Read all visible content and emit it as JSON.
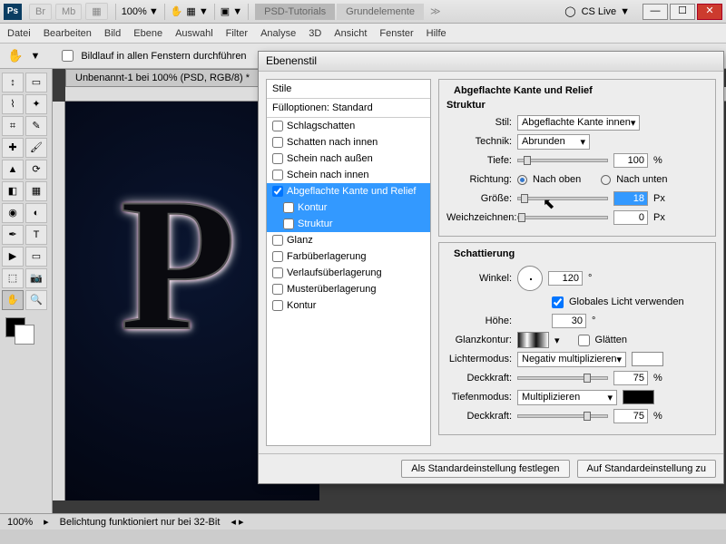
{
  "titlebar": {
    "zoom": "100%",
    "tabs": [
      "PSD-Tutorials",
      "Grundelemente"
    ],
    "cslive": "CS Live"
  },
  "menu": [
    "Datei",
    "Bearbeiten",
    "Bild",
    "Ebene",
    "Auswahl",
    "Filter",
    "Analyse",
    "3D",
    "Ansicht",
    "Fenster",
    "Hilfe"
  ],
  "options": {
    "scroll_all": "Bildlauf in allen Fenstern durchführen"
  },
  "doc": {
    "tab": "Unbenannt-1 bei 100% (PSD, RGB/8) *"
  },
  "dialog": {
    "title": "Ebenenstil",
    "list_header": "Stile",
    "blend_header": "Fülloptionen: Standard",
    "items": [
      {
        "label": "Schlagschatten",
        "on": false
      },
      {
        "label": "Schatten nach innen",
        "on": false
      },
      {
        "label": "Schein nach außen",
        "on": false
      },
      {
        "label": "Schein nach innen",
        "on": false
      },
      {
        "label": "Abgeflachte Kante und Relief",
        "on": true,
        "sel": true
      },
      {
        "label": "Kontur",
        "on": false,
        "sub": true,
        "sel": true
      },
      {
        "label": "Struktur",
        "on": false,
        "sub": true,
        "sel": true
      },
      {
        "label": "Glanz",
        "on": false
      },
      {
        "label": "Farbüberlagerung",
        "on": false
      },
      {
        "label": "Verlaufsüberlagerung",
        "on": false
      },
      {
        "label": "Musterüberlagerung",
        "on": false
      },
      {
        "label": "Kontur",
        "on": false
      }
    ],
    "panel_title": "Abgeflachte Kante und Relief",
    "struktur": "Struktur",
    "stil_label": "Stil:",
    "stil_value": "Abgeflachte Kante innen",
    "technik_label": "Technik:",
    "technik_value": "Abrunden",
    "tiefe_label": "Tiefe:",
    "tiefe_value": "100",
    "pct": "%",
    "richtung_label": "Richtung:",
    "richtung_up": "Nach oben",
    "richtung_down": "Nach unten",
    "size_label": "Größe:",
    "size_value": "18",
    "px": "Px",
    "soften_label": "Weichzeichnen:",
    "soften_value": "0",
    "schatt": "Schattierung",
    "winkel_label": "Winkel:",
    "winkel_value": "120",
    "deg": "°",
    "global_light": "Globales Licht verwenden",
    "hoehe_label": "Höhe:",
    "hoehe_value": "30",
    "glanz_label": "Glanzkontur:",
    "glaetten": "Glätten",
    "licht_label": "Lichtermodus:",
    "licht_value": "Negativ multiplizieren",
    "deck_label": "Deckkraft:",
    "deck_value": "75",
    "tiefen_label": "Tiefenmodus:",
    "tiefen_value": "Multiplizieren",
    "deck2_value": "75",
    "btn_default": "Als Standardeinstellung festlegen",
    "btn_reset": "Auf Standardeinstellung zu"
  },
  "status": {
    "zoom": "100%",
    "msg": "Belichtung funktioniert nur bei 32-Bit"
  }
}
